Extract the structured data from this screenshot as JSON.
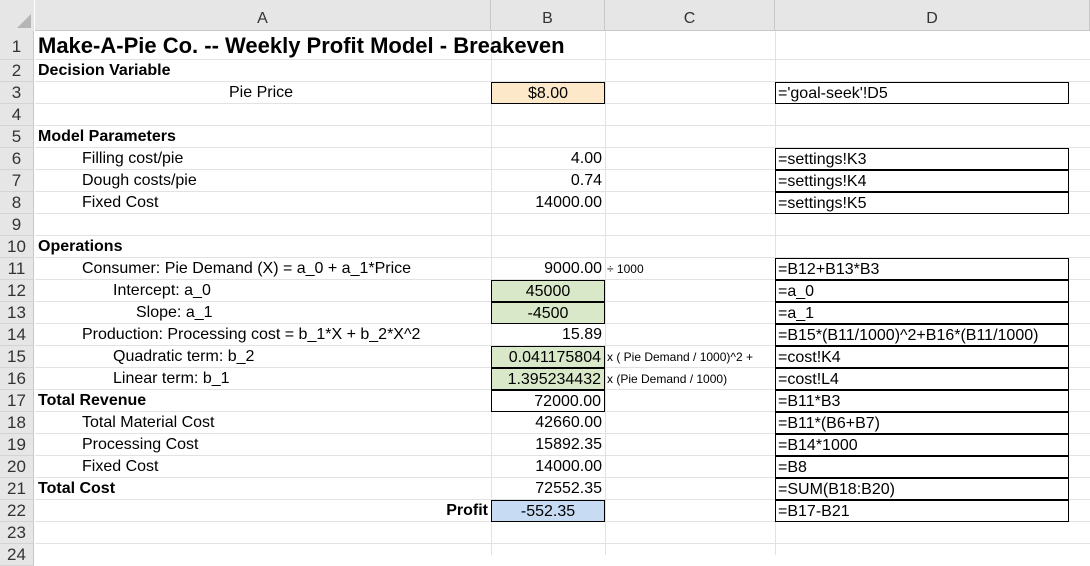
{
  "columns": [
    "A",
    "B",
    "C",
    "D"
  ],
  "rows": [
    "1",
    "2",
    "3",
    "4",
    "5",
    "6",
    "7",
    "8",
    "9",
    "10",
    "11",
    "12",
    "13",
    "14",
    "15",
    "16",
    "17",
    "18",
    "19",
    "20",
    "21",
    "22",
    "23",
    "24"
  ],
  "cells": {
    "a1": "Make-A-Pie Co. -- Weekly Profit Model - Breakeven",
    "a2": "Decision Variable",
    "a3": "Pie Price",
    "b3": "$8.00",
    "d3": "='goal-seek'!D5",
    "a5": "Model Parameters",
    "a6": "Filling cost/pie",
    "b6": "4.00",
    "d6": "=settings!K3",
    "a7": "Dough costs/pie",
    "b7": "0.74",
    "d7": "=settings!K4",
    "a8": "Fixed Cost",
    "b8": "14000.00",
    "d8": "=settings!K5",
    "a10": "Operations",
    "a11": "Consumer:  Pie Demand (X) = a_0 + a_1*Price",
    "b11": "9000.00",
    "c11": "÷ 1000",
    "d11": "=B12+B13*B3",
    "a12": "Intercept: a_0",
    "b12": "45000",
    "d12": "=a_0",
    "a13": "Slope: a_1",
    "b13": "-4500",
    "d13": "=a_1",
    "a14": "Production: Processing cost = b_1*X + b_2*X^2",
    "b14": "15.89",
    "d14": "=B15*(B11/1000)^2+B16*(B11/1000)",
    "a15": "Quadratic term: b_2",
    "b15": "0.041175804",
    "c15": "x ( Pie Demand / 1000)^2 +",
    "d15": "=cost!K4",
    "a16": "Linear term: b_1",
    "b16": "1.395234432",
    "c16": "x (Pie Demand / 1000)",
    "d16": "=cost!L4",
    "a17": "Total Revenue",
    "b17": "72000.00",
    "d17": "=B11*B3",
    "a18": "Total Material Cost",
    "b18": "42660.00",
    "d18": "=B11*(B6+B7)",
    "a19": "Processing Cost",
    "b19": "15892.35",
    "d19": "=B14*1000",
    "a20": "Fixed Cost",
    "b20": "14000.00",
    "d20": "=B8",
    "a21": "Total Cost",
    "b21": "72552.35",
    "d21": "=SUM(B18:B20)",
    "a22": "Profit",
    "b22": "-552.35",
    "d22": "=B17-B21"
  },
  "colors": {
    "header_bg": "#e6e6e6",
    "price_fill": "#fde9c9",
    "param_fill": "#d8e8c8",
    "profit_fill": "#c7dbf2"
  }
}
